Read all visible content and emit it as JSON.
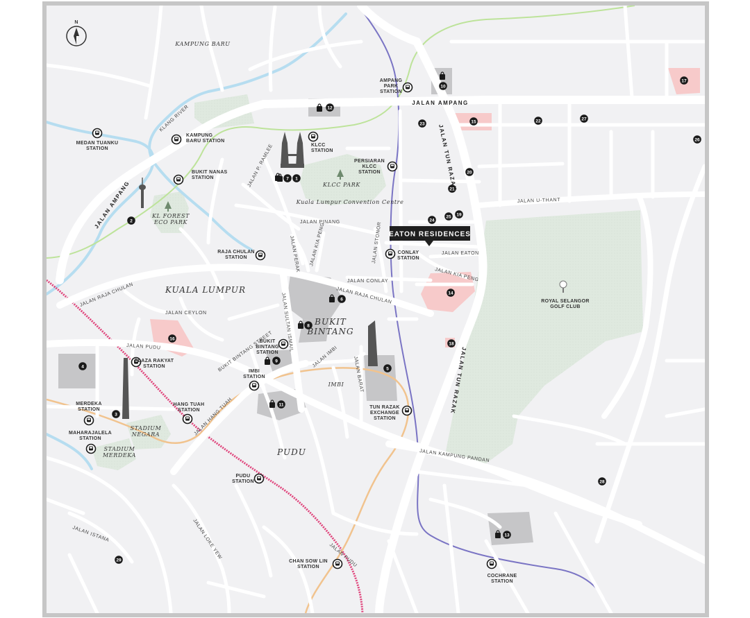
{
  "colors": {
    "frame": "#c6c6c6",
    "land": "#f1f1f3",
    "road": "#ffffff",
    "park": "#dfe9df",
    "building": "#c6c6c8",
    "highlight": "#f7caca",
    "river": "#b6ddf0",
    "rail_pink": "#e0457c",
    "rail_orange": "#f1c38e",
    "rail_purple": "#7a74c4",
    "rail_green": "#bde39a",
    "marker": "#1a1a1a",
    "callout": "#1f1f1f"
  },
  "icons": {
    "compass": "north-arrow-icon",
    "station": "train-station-icon",
    "shopping": "shopping-bag-icon",
    "tree": "tree-icon",
    "golf": "golf-ball-icon",
    "tower": "kl-tower-icon",
    "twin_towers": "petronas-towers-icon"
  },
  "compass_label": "N",
  "callout": "EATON RESIDENCES",
  "areas": {
    "kampung_baru": "KAMPUNG BARU",
    "kuala_lumpur": "KUALA LUMPUR",
    "bukit_bintang_1": "BUKIT",
    "bukit_bintang_2": "BINTANG",
    "imbi": "IMBI",
    "pudu": "PUDU",
    "klcc_park": "KLCC PARK",
    "kl_convention": "Kuala Lumpur Convention Centre",
    "kl_forest_1": "KL FOREST",
    "kl_forest_2": "ECO PARK",
    "stadium_negara_1": "STADIUM",
    "stadium_negara_2": "NEGARA",
    "stadium_merdeka_1": "STADIUM",
    "stadium_merdeka_2": "MERDEKA",
    "golf_1": "ROYAL SELANGOR",
    "golf_2": "GOLF CLUB"
  },
  "roads": {
    "jalan_ampang_top": "JALAN AMPANG",
    "jalan_tun_razak_top": "JALAN TUN RAZAK",
    "jalan_tun_razak_bottom": "JALAN TUN RAZAK",
    "jalan_ampang_left": "JALAN AMPANG",
    "jalan_u_thant": "JALAN U-THANT",
    "jalan_p_ramlee": "JALAN P. RAMLEE",
    "jalan_pinang": "JALAN PINANG",
    "jalan_perak": "JALAN PERAK",
    "jalan_kia_peng_1": "JALAN KIA PENG",
    "jalan_kia_peng_2": "JALAN KIA PENG",
    "jalan_stonor": "JALAN STONOR",
    "jalan_eaton": "JALAN EATON",
    "jalan_conlay": "JALAN CONLAY",
    "jalan_raja_chulan_1": "JALAN RAJA CHULAN",
    "jalan_raja_chulan_2": "JALAN RAJA CHULAN",
    "jalan_ceylon": "JALAN CEYLON",
    "jalan_sultan_ismail": "JALAN SULTAN ISMAIL",
    "jalan_pudu_1": "JALAN PUDU",
    "jalan_pudu_2": "JALAN PUDU",
    "bukit_bintang_street": "BUKIT BINTANG STREET",
    "jalan_imbi": "JALAN IMBI",
    "jalan_barat": "JALAN BARAT",
    "jalan_hang_tuah": "JALAN HANG TUAH",
    "jalan_kampung_pandan": "JALAN KAMPUNG PANDAN",
    "jalan_istana": "JALAN ISTANA",
    "jalan_loke_yew": "JALAN LOKE YEW",
    "klang_river": "KLANG RIVER"
  },
  "stations": [
    {
      "id": "ampang_park",
      "l1": "AMPANG",
      "l2": "PARK",
      "l3": "STATION"
    },
    {
      "id": "medan_tuanku",
      "l1": "MEDAN TUANKU",
      "l2": "STATION"
    },
    {
      "id": "kampung_baru",
      "l1": "KAMPUNG",
      "l2": "BARU STATION"
    },
    {
      "id": "klcc",
      "l1": "KLCC",
      "l2": "STATION"
    },
    {
      "id": "persiaran_klcc",
      "l1": "PERSIARAN",
      "l2": "KLCC",
      "l3": "STATION"
    },
    {
      "id": "bukit_nanas",
      "l1": "BUKIT NANAS",
      "l2": "STATION"
    },
    {
      "id": "raja_chulan",
      "l1": "RAJA CHULAN",
      "l2": "STATION"
    },
    {
      "id": "conlay",
      "l1": "CONLAY",
      "l2": "STATION"
    },
    {
      "id": "bukit_bintang",
      "l1": "BUKIT",
      "l2": "BINTANG",
      "l3": "STATION"
    },
    {
      "id": "plaza_rakyat",
      "l1": "PLAZA RAKYAT",
      "l2": "STATION"
    },
    {
      "id": "imbi",
      "l1": "IMBI",
      "l2": "STATION"
    },
    {
      "id": "merdeka",
      "l1": "MERDEKA",
      "l2": "STATION"
    },
    {
      "id": "hang_tuah",
      "l1": "HANG TUAH",
      "l2": "STATION"
    },
    {
      "id": "maharajalela",
      "l1": "MAHARAJALELA",
      "l2": "STATION"
    },
    {
      "id": "tun_razak_exchange",
      "l1": "TUN RAZAK",
      "l2": "EXCHANGE",
      "l3": "STATION"
    },
    {
      "id": "pudu",
      "l1": "PUDU",
      "l2": "STATION"
    },
    {
      "id": "chan_sow_lin",
      "l1": "CHAN SOW LIN",
      "l2": "STATION"
    },
    {
      "id": "cochrane",
      "l1": "COCHRANE",
      "l2": "STATION"
    }
  ],
  "markers": [
    "1",
    "2",
    "3",
    "4",
    "5",
    "6",
    "7",
    "8",
    "9",
    "10",
    "11",
    "12",
    "13",
    "14",
    "15",
    "16",
    "17",
    "19",
    "20",
    "21",
    "22",
    "23",
    "24",
    "25",
    "26",
    "27",
    "28",
    "29",
    "18"
  ]
}
